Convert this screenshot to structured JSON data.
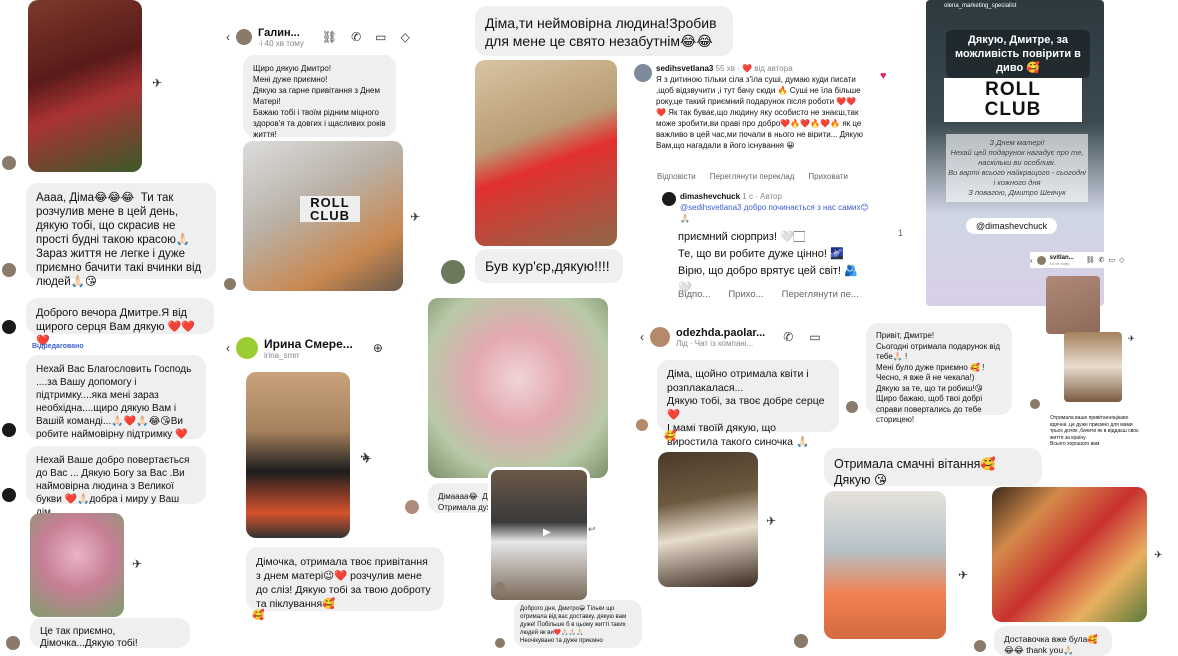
{
  "colors": {
    "bubble": "#efefef",
    "accent_blue": "#3c5fd0",
    "heart": "#e0245e"
  },
  "col1": {
    "msg1": "Аааа, Діма😂😂😂  Ти так розчулив мене в цей день, дякую тобі, що скрасив не прості будні такою красою🙏🏻 Зараз життя не легке і дуже приємно бачити такі вчинки від людей🙏🏻😘",
    "msg2": "Доброго вечора Дмитре.Я від щирого серця Вам дякую ❤️❤️❤️",
    "edited": "Відредаговано",
    "msg3": "Нехай Вас Благословить Господь ....за Вашу допомогу і підтримку....яка мені зараз необхідна....щиро дякую Вам і Вашій команді...🙏🏻❤️🙏🏻😂😘Ви робите наймовірну підтримку ❤️",
    "msg4": "Нехай Ваше добро повертається до Вас ... Дякую Богу за Вас .Ви наймовірна людина з Великої букви ❤️🙏🏻добра і миру у Ваш дім",
    "msg5": "Це так приємно, Дімочка...Дякую тобі!"
  },
  "col2": {
    "header_name": "Галин...",
    "header_sub": "·і 40 хв тому",
    "msg1": "Щиро дякую Дмитро!\nМені дуже приємно!\nДякую за гарне привітання з Днем Матері!\nБажаю тобі і твоїм рідним міцного здоров'я та довгих і щасливих років життя!",
    "roll_text": "ROLL\nCLUB",
    "header2_name": "Ирина Смере...",
    "header2_sub": "irina_smrr",
    "msg2": "Дімочка, отримала твоє привітання з днем матері😉❤️ розчулив мене до сліз! Дякую тобі за твою доброту та піклування🥰",
    "reaction2": "🥰"
  },
  "col3": {
    "msg1": "Діма,ти неймовірна людина!Зробив для мене це свято незабутнім😂😂",
    "msg2": "Був кур'єр,дякую!!!!",
    "msg3": "Дімаааа😂  Дякую!\nОтримала дуже...",
    "msg4": "Доброго дня, Дмитро😀 Тільки що отримала від вас доставку, дякую вам дуже! Побільше б в цьому житті таких людей як ви❤️🙏🏻🙏🏻🙏🏻\nНеочікувано та дуже приємно"
  },
  "comment": {
    "user1": "sedihsvetlana3",
    "meta1": "55 хв · ❤️ від автора",
    "text1": "Я з дитиною тільки сіла з'їла суші, думаю куди писати ,щоб відзвучити ,і тут бачу сюди 🔥 Суші не їла більше року,це такий приємний подарунок після роботи ❤️❤️❤️ Як так буває,що людину яку особисто не знаєш,так може зробити,ви праві про добро❤️🔥❤️🔥❤️🔥 як це важливо в цей час,ми почали в нього не вірити... Дякую Вам,що нагадали в його існування 😀",
    "actions1": [
      "Відповісти",
      "Переглянути переклад",
      "Приховати"
    ],
    "user2": "dimashevchuck",
    "meta2": "1 с · Автор",
    "text2_small": "@sedihsvetlana3 добро починається з нас самих😊🙏🏻",
    "text2_big": "приємний сюрприз! 🤍🏻\nТе, що ви робите дуже цінно! 🌌\nВірю, що добро врятує цей світ! 🫂\n🤍",
    "actions2": [
      "Відпо...",
      "Прихо...",
      "Переглянути пе..."
    ],
    "likes": "1"
  },
  "col4": {
    "header_name": "odezhda.paolar...",
    "header_sub": "Лід · Чат із компані...",
    "msg1": "Діма, щойно отримала квіти і розплакалася...\nДякую тобі, за твоє добре серце ❤️\nІ мамі твоїй дякую, що виростила такого синочка 🙏🏻",
    "reaction1": "🥰"
  },
  "col5": {
    "story_user": "olena_marketing_specialist",
    "story_text": "Дякую, Дмитре, за можливість повірити в диво 🥰",
    "roll_text": "ROLL\nCLUB",
    "card_text": "З Днем матері!\nНехай цей подарунок нагадує про те, наскільки ви особливі.\nВи варті всього найкращого - сьогодні і кожного дня\nЗ повагою, Дмитро Шевчук",
    "tag": "@dimashevchuck",
    "msg1": "Привіт, Дмитре!\nСьогодні отримала подарунок від тебе🙏🏻 !\nМені було дуже приємно 🥰 !\nЧесно, я вже й не чекала!)\nДякую за те, що ти робиш!😘\nЩиро бажаю, щоб твоі добрі справи повертались до тебе сторицею!",
    "msg2": "Отримала смачні вітання🥰 Дякую 😘",
    "msg3": "Доставочка вже була🥰😂😂 thank you🙏🏻",
    "small_header": "svitlan...",
    "small_sub": "14 хв тому",
    "small_msg": "Отримала ваше привітанняцікаво вдячна ,це дуже приємно для мами трьох дочок ,бачити як в віддаєш своє життя за країну\nВсього хорошого вам"
  }
}
